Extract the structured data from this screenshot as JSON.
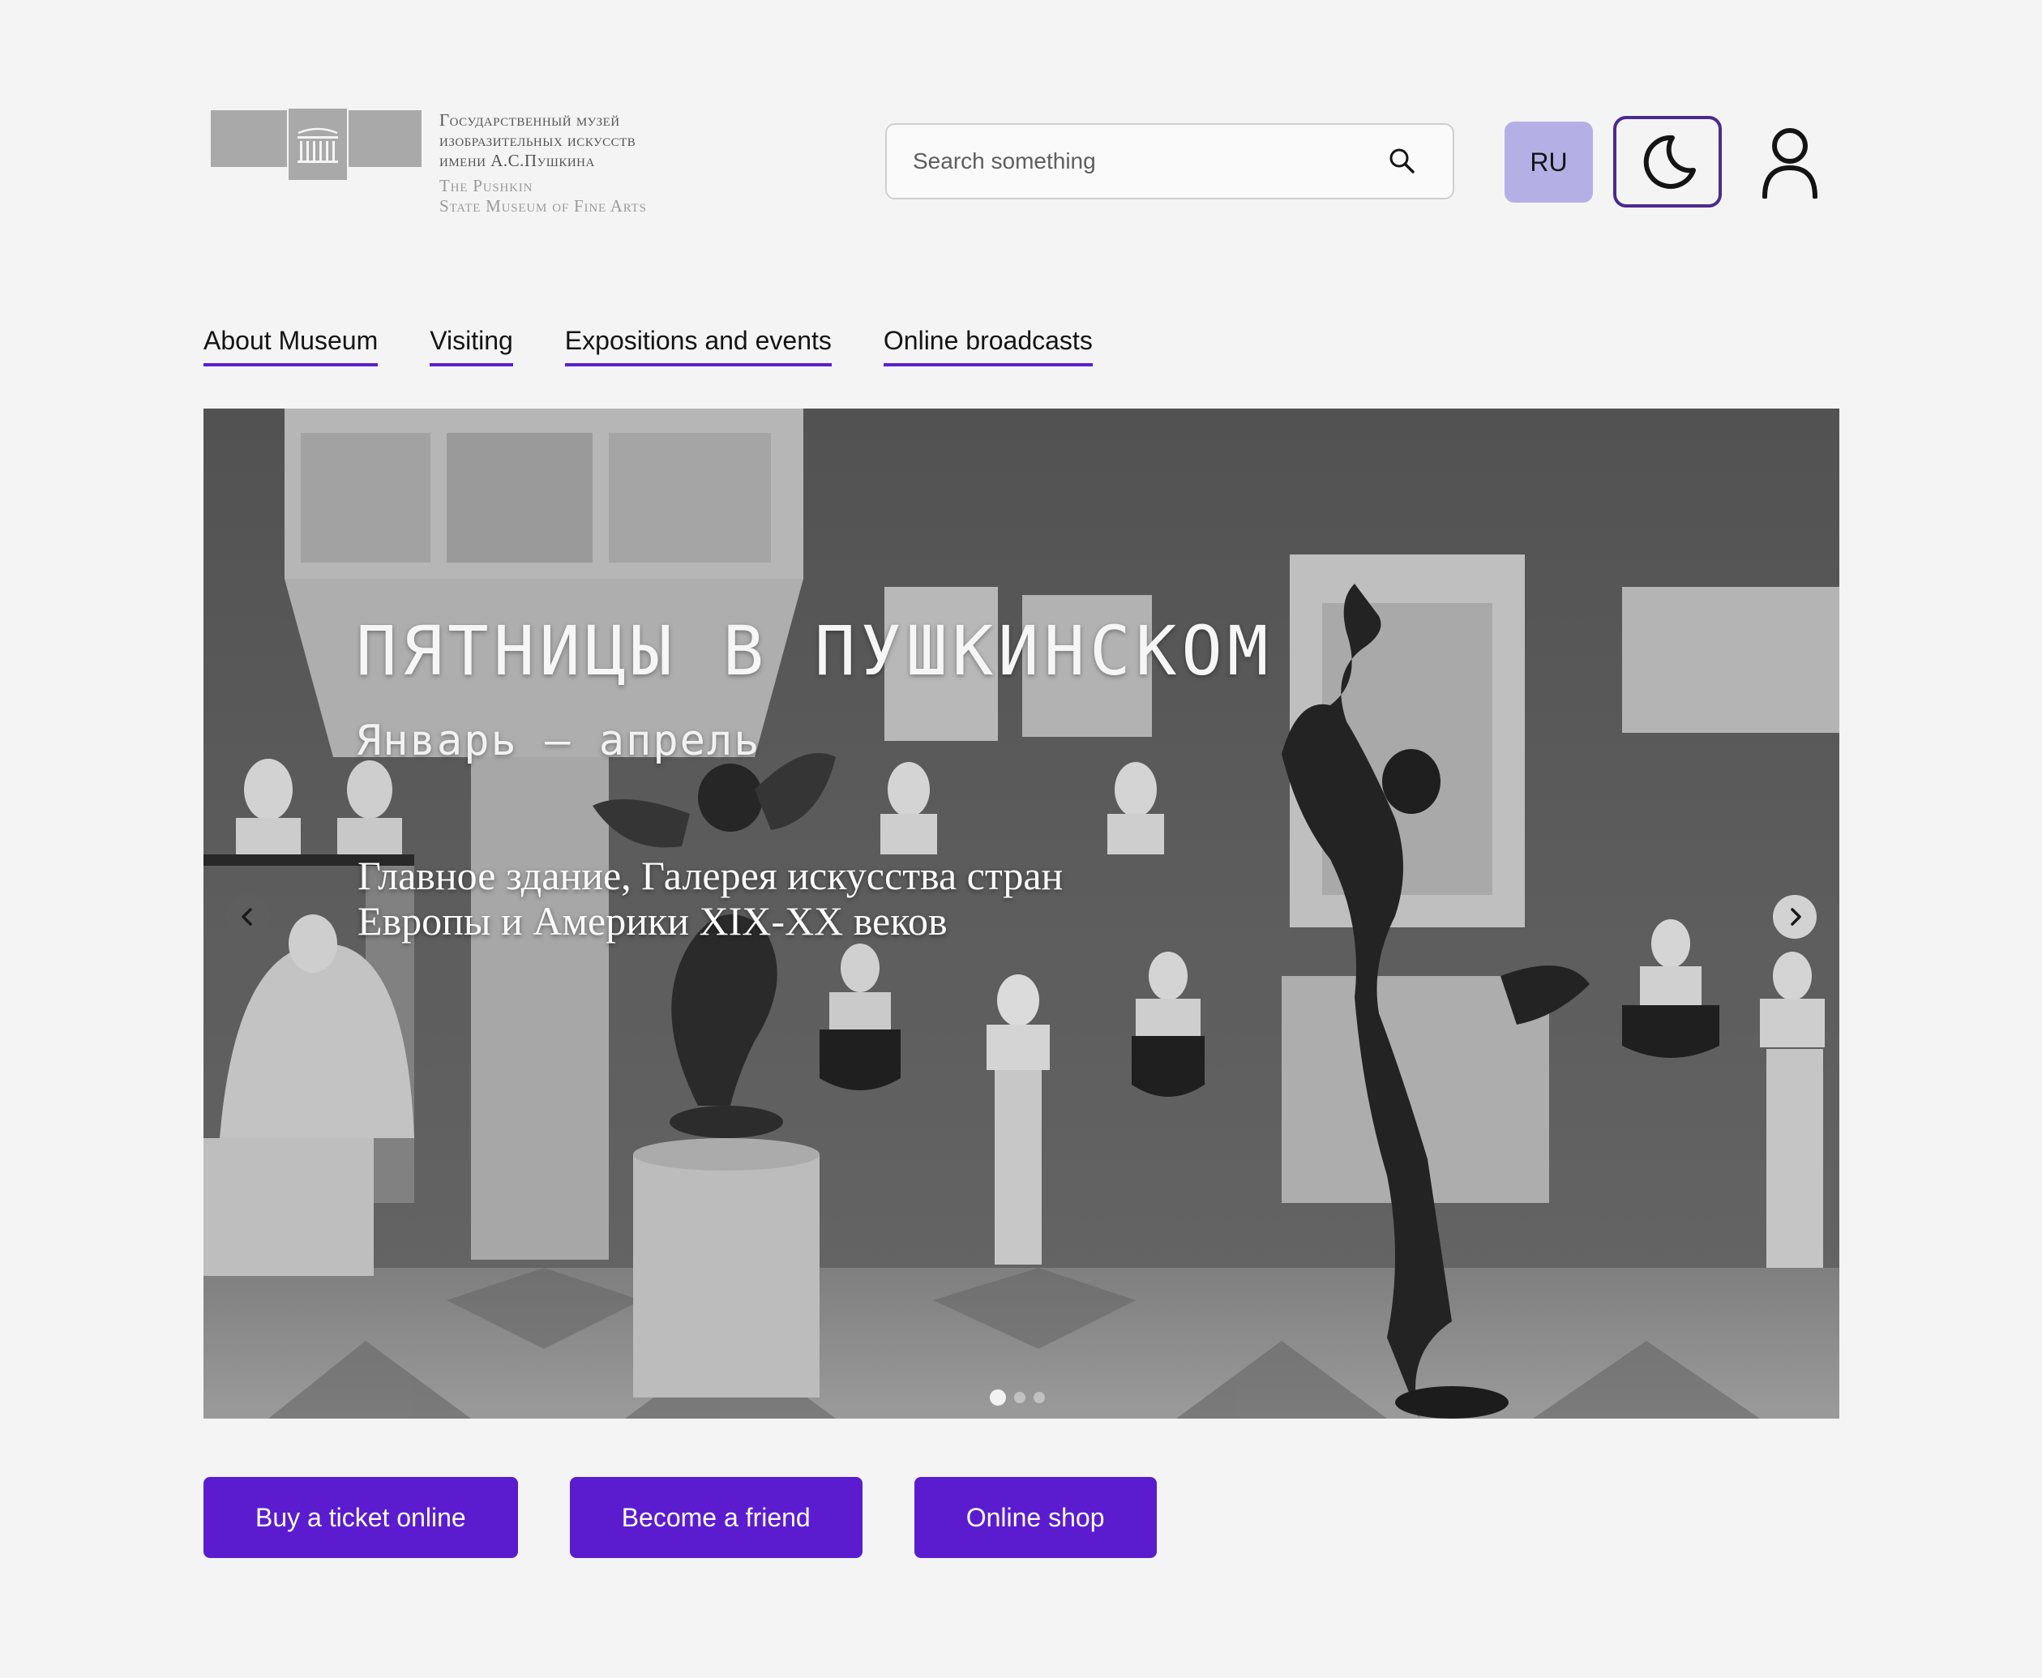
{
  "header": {
    "logo": {
      "ru_lines": [
        "Государственный музей",
        "изобразительных искусств",
        "имени А.С.Пушкина"
      ],
      "en_lines": [
        "The Pushkin",
        "State Museum of Fine Arts"
      ]
    },
    "search": {
      "placeholder": "Search something",
      "value": "",
      "icon": "search-icon"
    },
    "lang_label": "RU",
    "theme_icon": "moon-icon",
    "user_icon": "user-icon"
  },
  "nav": [
    "About Museum",
    "Visiting",
    "Expositions and events",
    "Online broadcasts"
  ],
  "hero": {
    "title": "ПЯТНИЦЫ В ПУШКИНСКОМ",
    "dates": "Январь — апрель",
    "place_lines": [
      "Главное здание, Галерея искусства стран",
      "Европы и Америки XIX-XX веков"
    ],
    "slides_total": 3,
    "active_slide": 1,
    "prev_icon": "chevron-left-icon",
    "next_icon": "chevron-right-icon"
  },
  "ctas": [
    "Buy a ticket online",
    "Become a friend",
    "Online shop"
  ],
  "colors": {
    "background": "#f4f4f4",
    "accent": "#5b1ccf",
    "lang_button": "#b4b0e6",
    "theme_border": "#4b2a8e"
  }
}
